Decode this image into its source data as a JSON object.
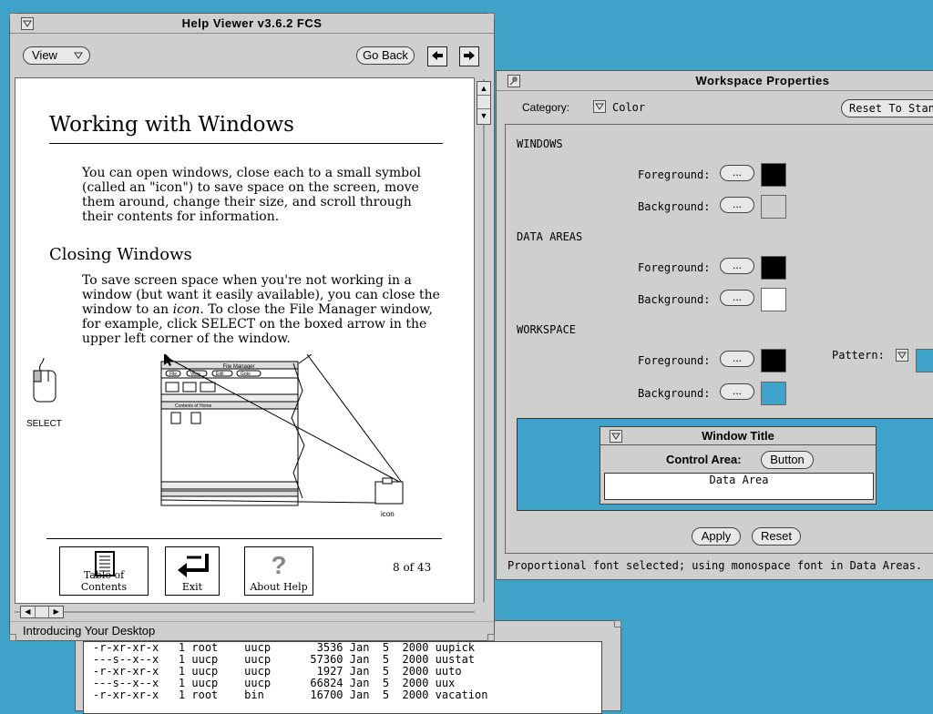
{
  "terminal": {
    "lines": [
      "-r-xr-xr-x   1 root    uucp       3536 Jan  5  2000 uupick",
      "---s--x--x   1 uucp    uucp      57360 Jan  5  2000 uustat",
      "-r-xr-xr-x   1 uucp    uucp       1927 Jan  5  2000 uuto",
      "---s--x--x   1 uucp    uucp      66824 Jan  5  2000 uux",
      "-r-xr-xr-x   1 root    bin       16700 Jan  5  2000 vacation"
    ]
  },
  "help_viewer": {
    "title": "Help Viewer v3.6.2 FCS",
    "view_label": "View",
    "go_back_label": "Go Back",
    "status": "Introducing Your Desktop",
    "doc": {
      "heading": "Working with Windows",
      "intro": "You can open windows, close each to a small symbol (called an \"icon\") to save space on the screen, move them around, change their size, and scroll through their contents for information.",
      "subheading": "Closing Windows",
      "body_1": "To save screen space when you're not working in a window (but want it easily available), you can close the window to an ",
      "body_icon_word": "icon.",
      "body_2": " To close the File Manager window, for example, click SELECT on the boxed arrow in the upper left corner of the window.",
      "select_label": "SELECT",
      "figure": {
        "window_title": "File Manager",
        "menus": [
          "File",
          "View",
          "Edit",
          "Goto"
        ],
        "contents_label": "Contents of Home",
        "icon_label": "icon"
      },
      "nav": {
        "toc_label": "Table of Contents",
        "exit_label": "Exit",
        "about_label": "About Help",
        "page_info": "8 of 43"
      }
    }
  },
  "workspace": {
    "title": "Workspace Properties",
    "category_label": "Category:",
    "category_value": "Color",
    "reset_standard_label": "Reset To Standard",
    "sections": {
      "windows": "WINDOWS",
      "data_areas": "DATA AREAS",
      "workspace": "WORKSPACE"
    },
    "foreground_label": "Foreground:",
    "background_label": "Background:",
    "pattern_label": "Pattern:",
    "dots_label": "...",
    "colors": {
      "windows_fg": "#000000",
      "windows_bg": "#cfcfcf",
      "data_fg": "#000000",
      "data_bg": "#ffffff",
      "workspace_fg": "#000000",
      "workspace_bg": "#3fa2c8"
    },
    "preview": {
      "window_title": "Window Title",
      "control_area_label": "Control Area:",
      "button_label": "Button",
      "data_area_label": "Data Area"
    },
    "apply_label": "Apply",
    "reset_label": "Reset",
    "status": "Proportional font selected; using monospace font in Data Areas."
  }
}
